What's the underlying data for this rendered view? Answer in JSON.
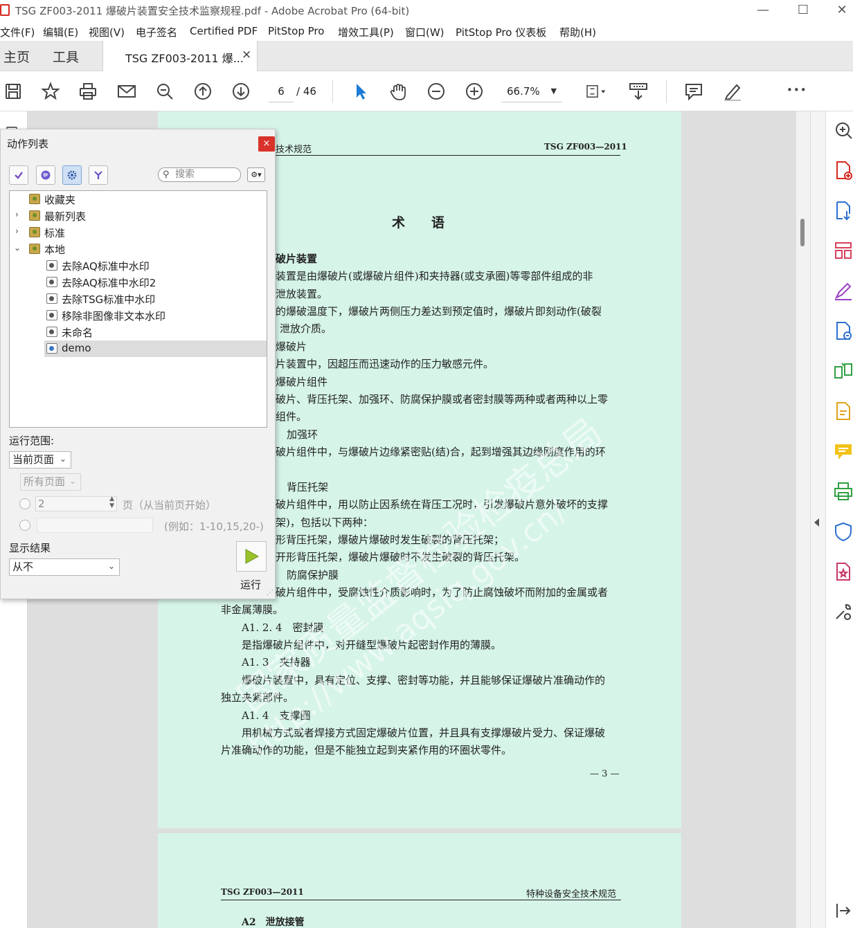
{
  "window": {
    "title": "TSG ZF003-2011 爆破片装置安全技术监察规程.pdf - Adobe Acrobat Pro (64-bit)",
    "minimize": "—",
    "maximize": "☐",
    "close": "✕"
  },
  "menu": [
    "文件(F)",
    "编辑(E)",
    "视图(V)",
    "电子签名",
    "Certified PDF",
    "PitStop Pro",
    "增效工具(P)",
    "窗口(W)",
    "PitStop Pro 仪表板",
    "帮助(H)"
  ],
  "tabs": {
    "home": "主页",
    "tools": "工具",
    "document": "TSG ZF003-2011 爆...",
    "close": "×"
  },
  "toolbar": {
    "page_current": "6",
    "page_total": "/ 46",
    "zoom": "66.7%",
    "more": "•••"
  },
  "action_panel": {
    "title": "动作列表",
    "close": "×",
    "search_placeholder": "搜索",
    "tree": [
      {
        "label": "收藏夹",
        "type": "folder"
      },
      {
        "label": "最新列表",
        "type": "folder"
      },
      {
        "label": "标准",
        "type": "folder"
      },
      {
        "label": "本地",
        "type": "folder"
      },
      {
        "label": "去除AQ标准中水印",
        "type": "action"
      },
      {
        "label": "去除AQ标准中水印2",
        "type": "action"
      },
      {
        "label": "去除TSG标准中水印",
        "type": "action"
      },
      {
        "label": "移除非图像非文本水印",
        "type": "action"
      },
      {
        "label": "未命名",
        "type": "action"
      },
      {
        "label": "demo",
        "type": "action",
        "selected": true
      }
    ],
    "run_scope_label": "运行范围:",
    "scope_select": "当前页面",
    "all_pages_select": "所有页面",
    "page_count_value": "2",
    "page_suffix": "页（从当前页开始）",
    "range_example": "(例如：1-10,15,20-)",
    "show_result_label": "显示结果",
    "show_result_select": "从不",
    "run_label": "运行"
  },
  "page1": {
    "header_left": "技术规范",
    "header_right": "TSG ZF003—2011",
    "heading": "术　　语",
    "lines": [
      "破片装置",
      "装置是由爆破片(或爆破片组件)和夹持器(或支承圈)等零部件组成的非",
      "泄放装置。",
      "的爆破温度下，爆破片两侧压力差达到预定值时，爆破片即刻动作(破裂",
      "泄放介质。",
      "爆破片",
      "片装置中，因超压而迅速动作的压力敏感元件。",
      "爆破片组件",
      "破片、背压托架、加强环、防腐保护膜或者密封膜等两种或者两种以上零",
      "组件。",
      "加强环",
      "破片组件中，与爆破片边缘紧密贴(结)合，起到增强其边缘刚度作用的环",
      "背压托架",
      "破片组件中，用以防止因系统在背压工况时，引发爆破片意外破坏的支撑",
      "架)，包括以下两种：",
      "形背压托架，爆破片爆破时发生破裂的背压托架；",
      "开形背压托架，爆破片爆破时不发生破裂的背压托架。",
      "防腐保护膜",
      "破片组件中，受腐蚀性介质影响时，为了防止腐蚀破坏而附加的金属或者",
      "非金属薄膜。",
      "A1. 2. 4　密封膜",
      "是指爆破片组件中，对开缝型爆破片起密封作用的薄膜。",
      "A1. 3　夹持器",
      "爆破片装置中，具有定位、支撑、密封等功能，并且能够保证爆破片准确动作的",
      "独立夹紧部件。",
      "A1. 4　支撑圈",
      "用机械方式或者焊接方式固定爆破片位置，并且具有支撑爆破片受力、保证爆破",
      "片准确动作的功能，但是不能独立起到夹紧作用的环圈状零件。"
    ],
    "page_number": "— 3 —",
    "watermark_cn": "国家质量监督检验检疫总局",
    "watermark_url": "http://www.aqsiq.gov.cn/"
  },
  "page2": {
    "header_left": "TSG ZF003—2011",
    "header_right": "特种设备安全技术规范",
    "first_line": "A2　泄放接管"
  },
  "colors": {
    "page_bg": "#d6f4e8",
    "accent_red": "#d9322a",
    "select_blue": "#1a7cd6"
  }
}
